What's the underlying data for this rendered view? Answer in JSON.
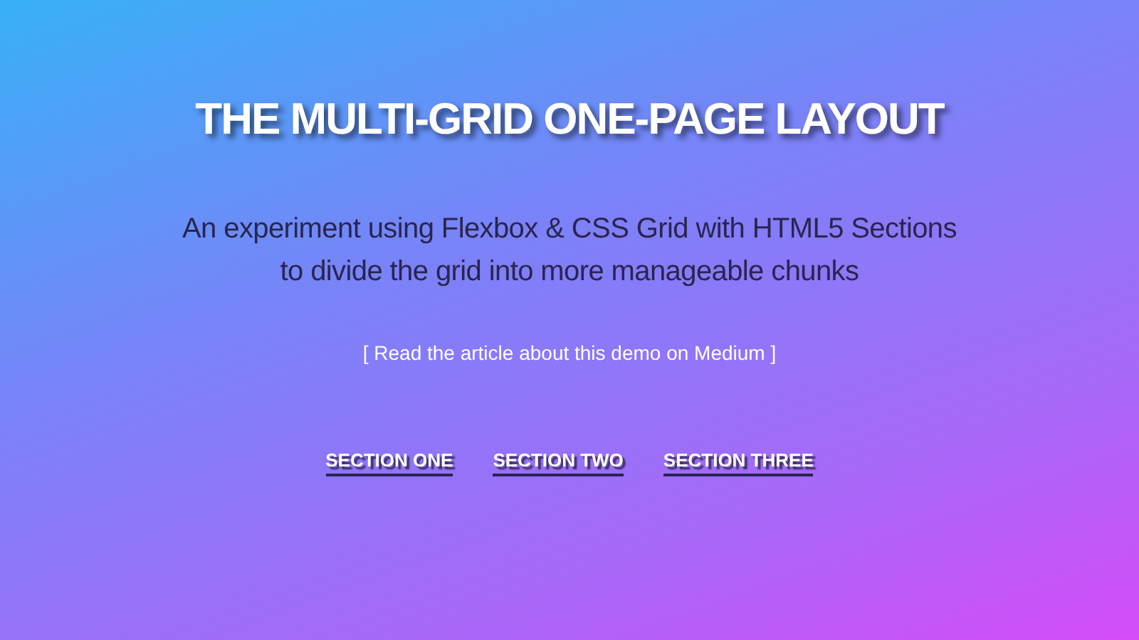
{
  "title": "THE MULTI-GRID ONE-PAGE LAYOUT",
  "subtitle_lines": [
    "An experiment using Flexbox & CSS Grid with HTML5 Sections",
    "to divide the grid into more manageable chunks"
  ],
  "article_link": "[ Read the article about this demo on Medium ]",
  "nav": [
    "SECTION ONE",
    "SECTION TWO",
    "SECTION THREE"
  ]
}
